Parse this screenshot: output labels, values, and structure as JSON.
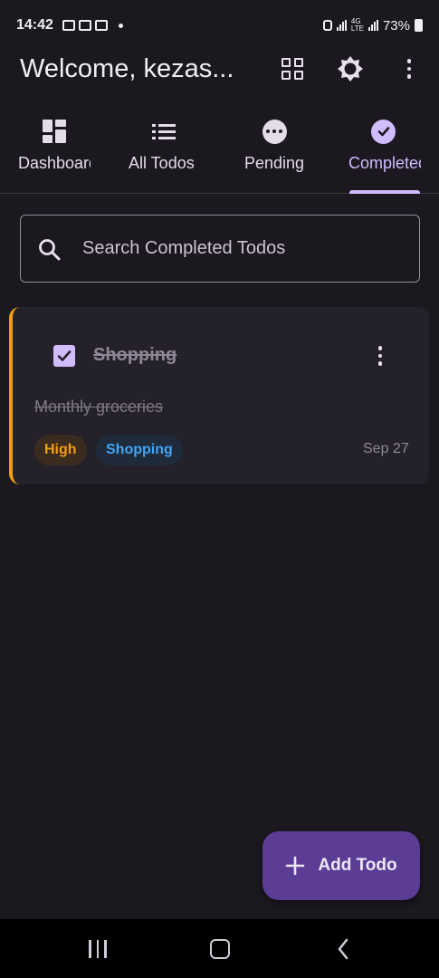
{
  "status_bar": {
    "time": "14:42",
    "network": "4G",
    "network_sub": "LTE",
    "battery": "73%"
  },
  "app_bar": {
    "title": "Welcome, kezas...",
    "actions": [
      "grid-view-icon",
      "brightness-icon",
      "more-vertical-icon"
    ]
  },
  "tabs": [
    {
      "label": "Dashboard",
      "icon": "dashboard-icon",
      "active": false
    },
    {
      "label": "All Todos",
      "icon": "list-icon",
      "active": false
    },
    {
      "label": "Pending",
      "icon": "pending-icon",
      "active": false
    },
    {
      "label": "Completed",
      "icon": "check-circle-icon",
      "active": true
    }
  ],
  "search": {
    "placeholder": "Search Completed Todos",
    "value": ""
  },
  "todos": [
    {
      "title": "Shopping",
      "description": "Monthly groceries",
      "completed": true,
      "priority": "High",
      "category": "Shopping",
      "date": "Sep 27"
    }
  ],
  "fab": {
    "label": "Add Todo"
  },
  "colors": {
    "background": "#1b1820",
    "accent": "#d0bcff",
    "priority_high": "#f29d12",
    "category": "#42a5f5",
    "fab": "#5b3d96"
  }
}
